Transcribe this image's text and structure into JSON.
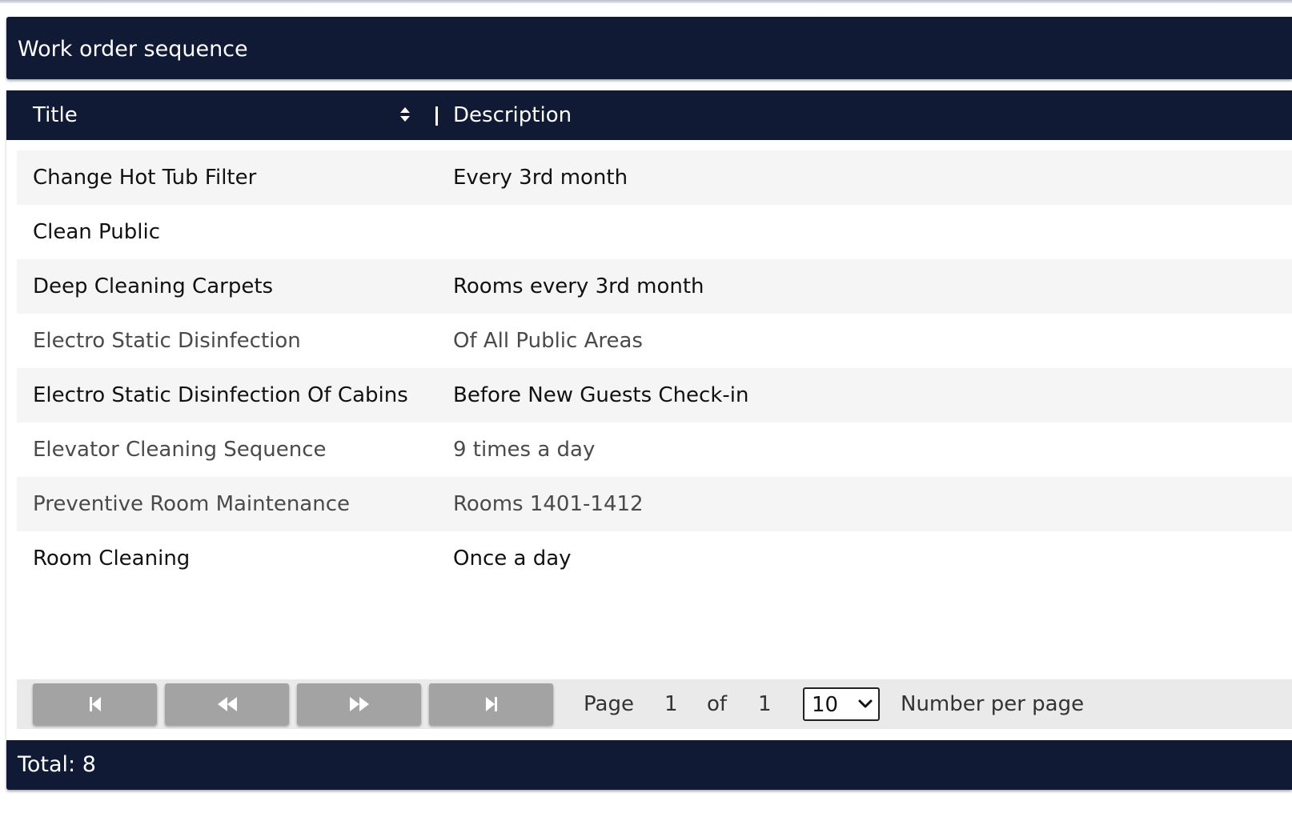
{
  "panel": {
    "title": "Work order sequence"
  },
  "table": {
    "columns": [
      {
        "label": "Title",
        "sortable": true
      },
      {
        "label": "Description"
      }
    ],
    "rows": [
      {
        "title": "Change Hot Tub Filter",
        "description": "Every 3rd month"
      },
      {
        "title": "Clean Public",
        "description": ""
      },
      {
        "title": "Deep Cleaning Carpets",
        "description": "Rooms every 3rd month"
      },
      {
        "title": "Electro Static Disinfection",
        "description": "Of All Public Areas"
      },
      {
        "title": "Electro Static Disinfection Of Cabins",
        "description": "Before New Guests Check-in"
      },
      {
        "title": "Elevator Cleaning Sequence",
        "description": "9 times a day"
      },
      {
        "title": "Preventive Room Maintenance",
        "description": "Rooms 1401-1412"
      },
      {
        "title": "Room Cleaning",
        "description": "Once a day"
      }
    ]
  },
  "pager": {
    "buttons": [
      {
        "name": "first-page-button",
        "icon": "skip-first-icon"
      },
      {
        "name": "prev-page-button",
        "icon": "rewind-icon"
      },
      {
        "name": "next-page-button",
        "icon": "fast-forward-icon"
      },
      {
        "name": "last-page-button",
        "icon": "skip-last-icon"
      }
    ],
    "page_label": "Page",
    "current_page": "1",
    "of_label": "of",
    "total_pages": "1",
    "per_page": "10",
    "per_page_label": "Number per page"
  },
  "footer": {
    "total": "Total: 8"
  },
  "colors": {
    "header_bg": "#111a35",
    "row_alt_bg": "#f5f5f5",
    "pager_bg": "#eaeaea",
    "pager_button_bg": "#a3a3a3"
  }
}
